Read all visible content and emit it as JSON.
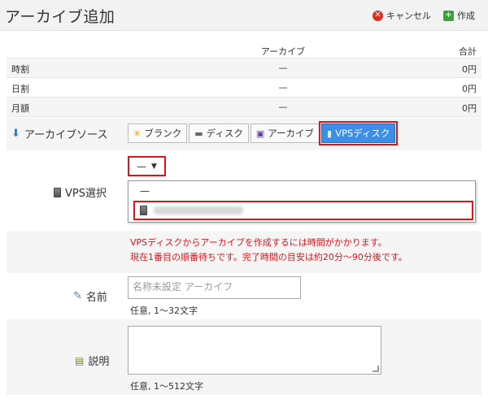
{
  "header": {
    "title": "アーカイブ追加",
    "cancel_label": "キャンセル",
    "create_label": "作成"
  },
  "price_table": {
    "col_archive": "アーカイブ",
    "col_total": "合計",
    "rows": [
      {
        "label": "時割",
        "archive": "—",
        "total": "0円"
      },
      {
        "label": "日割",
        "archive": "—",
        "total": "0円"
      },
      {
        "label": "月額",
        "archive": "—",
        "total": "0円"
      }
    ]
  },
  "archive_source": {
    "label": "アーカイブソース",
    "tabs": [
      {
        "label": "ブランク",
        "icon": "sparkle-icon"
      },
      {
        "label": "ディスク",
        "icon": "disk-icon"
      },
      {
        "label": "アーカイブ",
        "icon": "save-icon"
      },
      {
        "label": "VPSディスク",
        "icon": "server-icon",
        "active": true
      }
    ]
  },
  "vps_select": {
    "label": "VPS選択",
    "current_value": "—",
    "options": [
      "—",
      ""
    ]
  },
  "warning": {
    "line1": "VPSディスクからアーカイブを作成するには時間がかかります。",
    "line2": "現在1番目の順番待ちです。完了時間の目安は約20分〜90分後です。"
  },
  "name_field": {
    "label": "名前",
    "placeholder": "名称未設定 アーカイフ",
    "hint": "任意, 1〜32文字"
  },
  "desc_field": {
    "label": "説明",
    "hint": "任意, 1〜512文字"
  },
  "colors": {
    "accent": "#3c8ee6",
    "highlight": "#d9141d",
    "warning": "#e0161e"
  }
}
